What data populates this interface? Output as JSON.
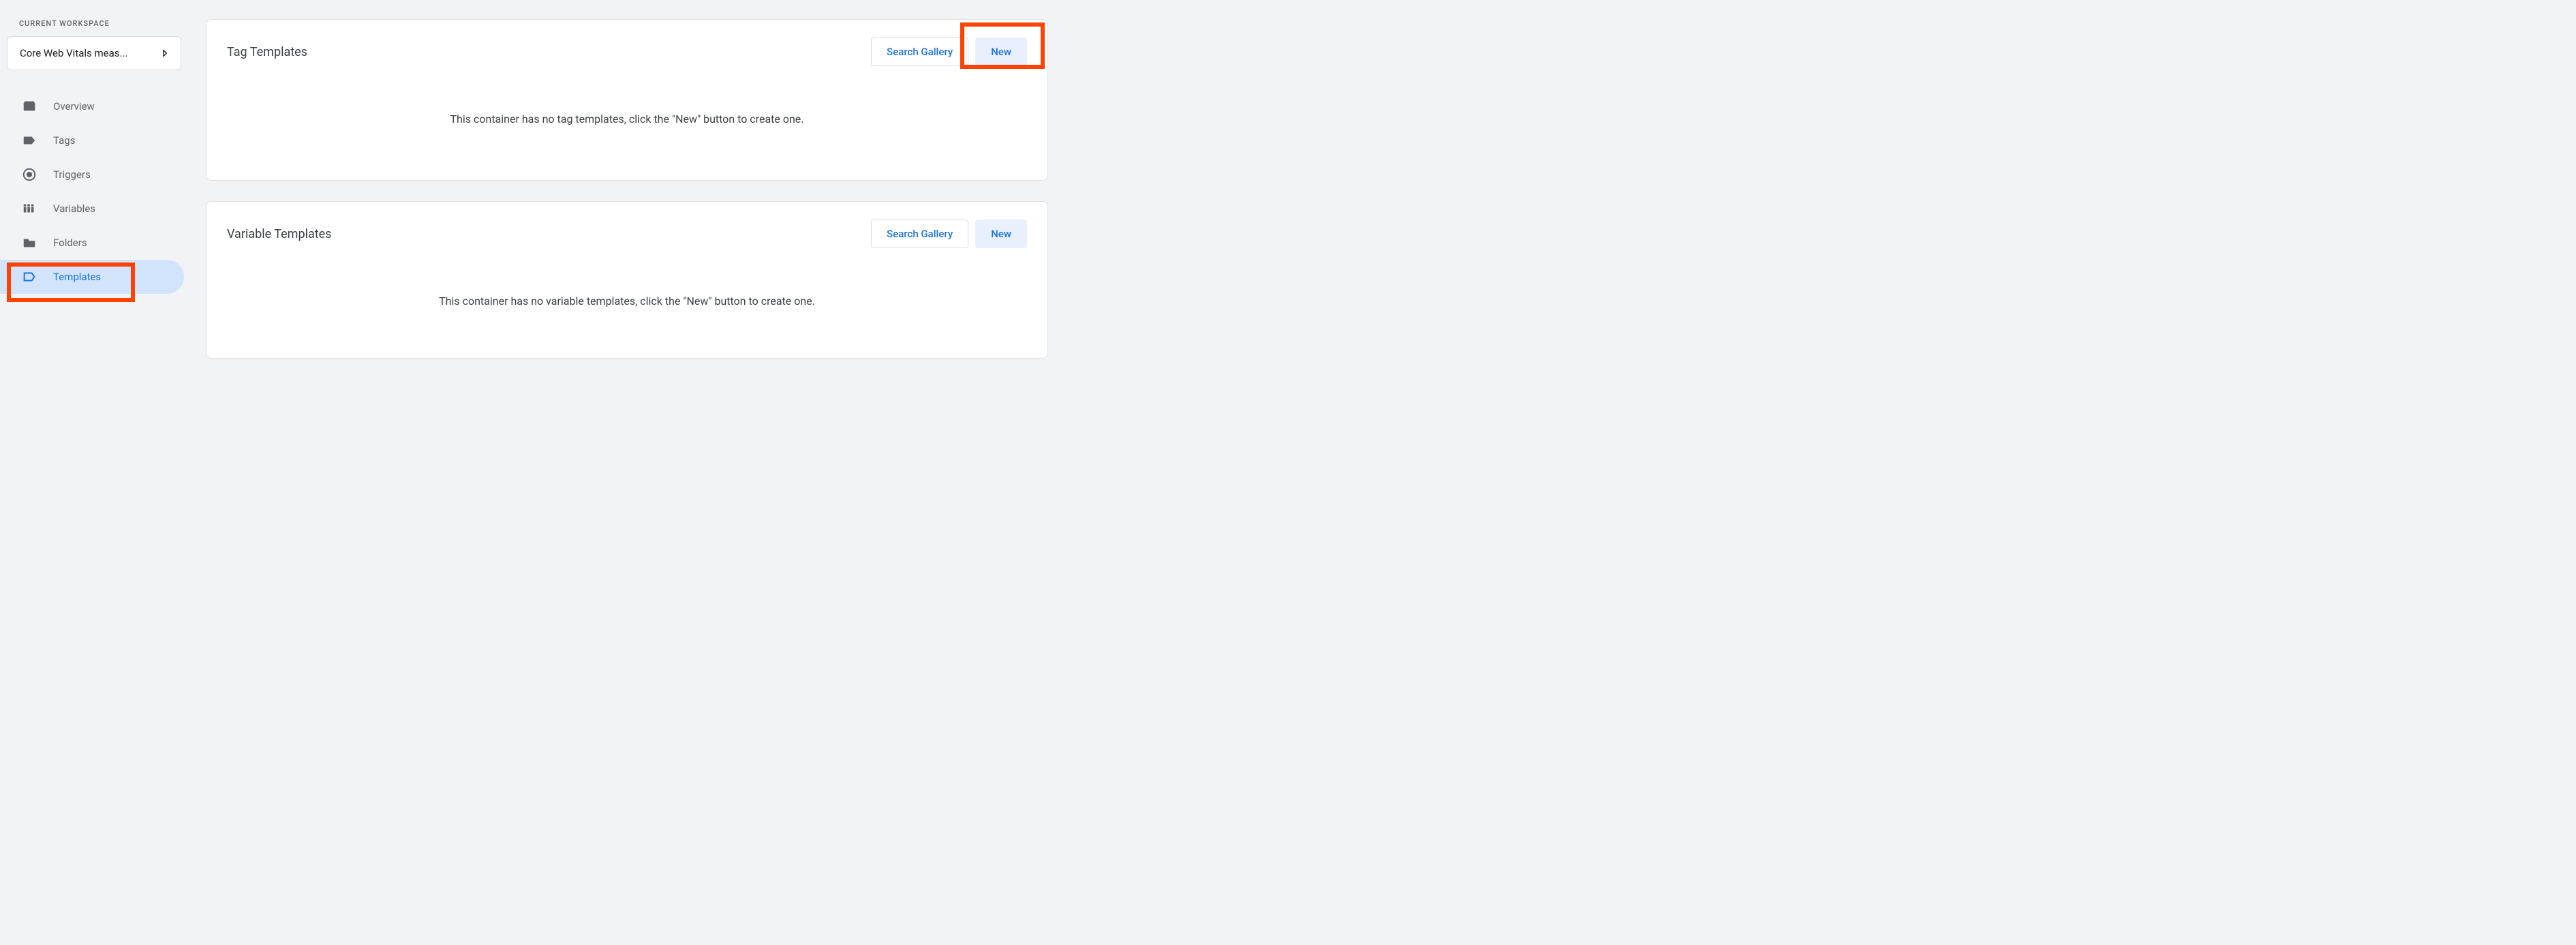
{
  "sidebar": {
    "workspace_label": "CURRENT WORKSPACE",
    "workspace_name": "Core Web Vitals meas...",
    "items": [
      {
        "label": "Overview"
      },
      {
        "label": "Tags"
      },
      {
        "label": "Triggers"
      },
      {
        "label": "Variables"
      },
      {
        "label": "Folders"
      },
      {
        "label": "Templates"
      }
    ],
    "active_index": 5
  },
  "cards": {
    "tag_templates": {
      "title": "Tag Templates",
      "search_gallery_label": "Search Gallery",
      "new_label": "New",
      "empty_message": "This container has no tag templates, click the \"New\" button to create one."
    },
    "variable_templates": {
      "title": "Variable Templates",
      "search_gallery_label": "Search Gallery",
      "new_label": "New",
      "empty_message": "This container has no variable templates, click the \"New\" button to create one."
    }
  }
}
